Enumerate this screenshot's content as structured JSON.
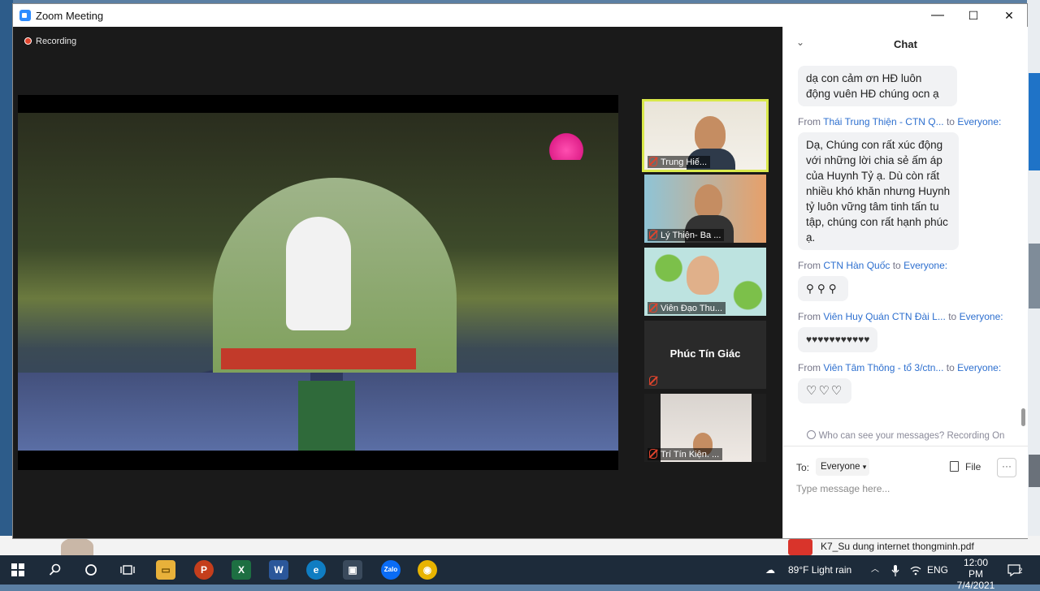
{
  "window": {
    "title": "Zoom Meeting",
    "minimize": "—",
    "maximize": "☐",
    "close": "✕"
  },
  "meeting": {
    "recording_label": "Recording",
    "participants": [
      {
        "name": "Trung Hiế..."
      },
      {
        "name": "Lý Thiện- Ba ..."
      },
      {
        "name": "Viên Đạo Thu..."
      },
      {
        "name": "Phúc Tín Giác"
      },
      {
        "name": "Trí Tín Kiện. ..."
      }
    ]
  },
  "chat": {
    "title": "Chat",
    "messages": [
      {
        "from": "",
        "to": "",
        "text": "dạ con cảm ơn HĐ luôn động vuên HĐ chúng ocn ạ"
      },
      {
        "from": "Thái Trung Thiện - CTN Q...",
        "to": "Everyone:",
        "text": "Dạ, Chúng con rất xúc động với những lời chia sẻ ấm áp của Huynh Tỷ ạ. Dù còn rất nhiều khó khăn nhưng Huynh tỷ luôn vững tâm tinh tấn tu tập, chúng con rất hạnh phúc ạ."
      },
      {
        "from": "CTN Hàn Quốc",
        "to": "Everyone:",
        "text": "⚲⚲⚲"
      },
      {
        "from": "Viên Huy Quán CTN Đài L...",
        "to": "Everyone:",
        "text": "♥♥♥♥♥♥♥♥♥♥♥"
      },
      {
        "from": "Viên Tâm Thông - tổ 3/ctn...",
        "to": "Everyone:",
        "text": "♡♡♡"
      }
    ],
    "from_word": "From",
    "to_word": "to",
    "notice": "Who can see your messages? Recording On",
    "to_label": "To:",
    "recipient": "Everyone",
    "file_label": "File",
    "more_label": "···",
    "input_placeholder": "Type message here..."
  },
  "desktop": {
    "doc_name": "K7_Su dung internet thongminh.pdf"
  },
  "taskbar": {
    "apps": [
      {
        "icon": "powerpoint-icon",
        "glyph": "P",
        "color": "#c43e1c"
      },
      {
        "icon": "excel-icon",
        "glyph": "X",
        "color": "#1d6f42"
      },
      {
        "icon": "word-icon",
        "glyph": "W",
        "color": "#2b579a"
      },
      {
        "icon": "edge-icon",
        "glyph": "e",
        "color": "#0f7dc2"
      },
      {
        "icon": "zoom-icon",
        "glyph": "▣",
        "color": "#2d8cff"
      },
      {
        "icon": "zalo-icon",
        "glyph": "Zalo",
        "color": "#0a6cf5"
      },
      {
        "icon": "chrome-icon",
        "glyph": "◉",
        "color": "#e8b400"
      }
    ],
    "weather": "89°F  Light rain",
    "lang": "ENG",
    "time": "12:00 PM",
    "date": "7/4/2021",
    "notif_count": "2"
  }
}
